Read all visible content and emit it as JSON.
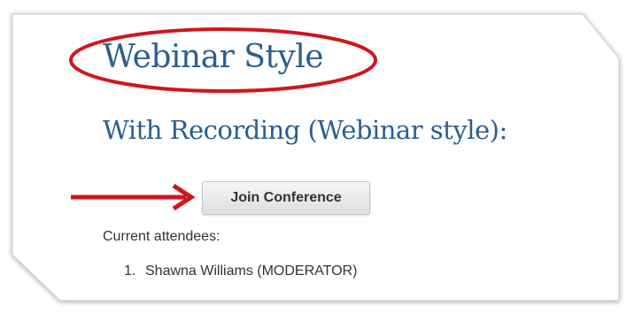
{
  "page": {
    "title": "Webinar Style",
    "subtitle": "With Recording (Webinar style):"
  },
  "conference": {
    "join_label": "Join Conference"
  },
  "attendees": {
    "label": "Current attendees:",
    "items": [
      {
        "number": "1.",
        "name": "Shawna Williams (MODERATOR)"
      }
    ]
  },
  "annotations": {
    "ellipse": {
      "color": "#d0161b",
      "target": "page-title"
    },
    "arrow": {
      "color": "#d0161b",
      "target": "join-conference-button"
    }
  },
  "colors": {
    "heading": "#2b5f8f",
    "text": "#333333",
    "annotation": "#d0161b"
  }
}
